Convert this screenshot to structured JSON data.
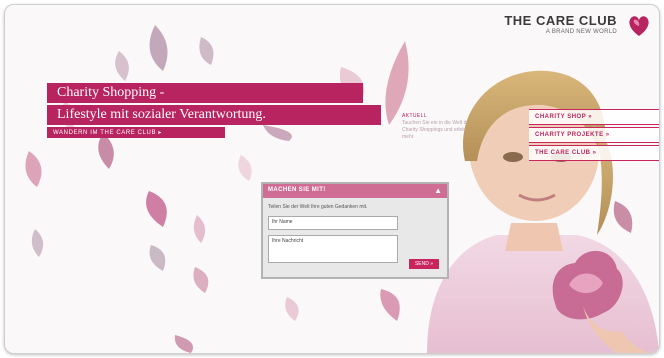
{
  "brand": {
    "name": "THE CARE CLUB",
    "tagline": "A BRAND NEW WORLD"
  },
  "hero": {
    "line1": "Charity Shopping -",
    "line2": "Lifestyle mit sozialer Verantwortung.",
    "line3": "WANDERN IM THE CARE CLUB ▸"
  },
  "teaser": {
    "heading": "AKTUELL",
    "body": "Tauchen Sie ein in die Welt des Charity Shoppings und erleben Sie mehr."
  },
  "nav": [
    {
      "label": "CHARITY SHOP »"
    },
    {
      "label": "CHARITY PROJEKTE »"
    },
    {
      "label": "THE CARE CLUB »"
    }
  ],
  "panel": {
    "title": "MACHEN SIE MIT!",
    "intro": "Teilen Sie der Welt Ihre guten Gedanken mit.",
    "name_value": "Ihr Name",
    "message_value": "Ihre Nachricht",
    "send_label": "SEND »"
  },
  "colors": {
    "accent": "#b8245f",
    "petal_pink": "#d98aaa",
    "petal_mauve": "#a98aa2"
  }
}
